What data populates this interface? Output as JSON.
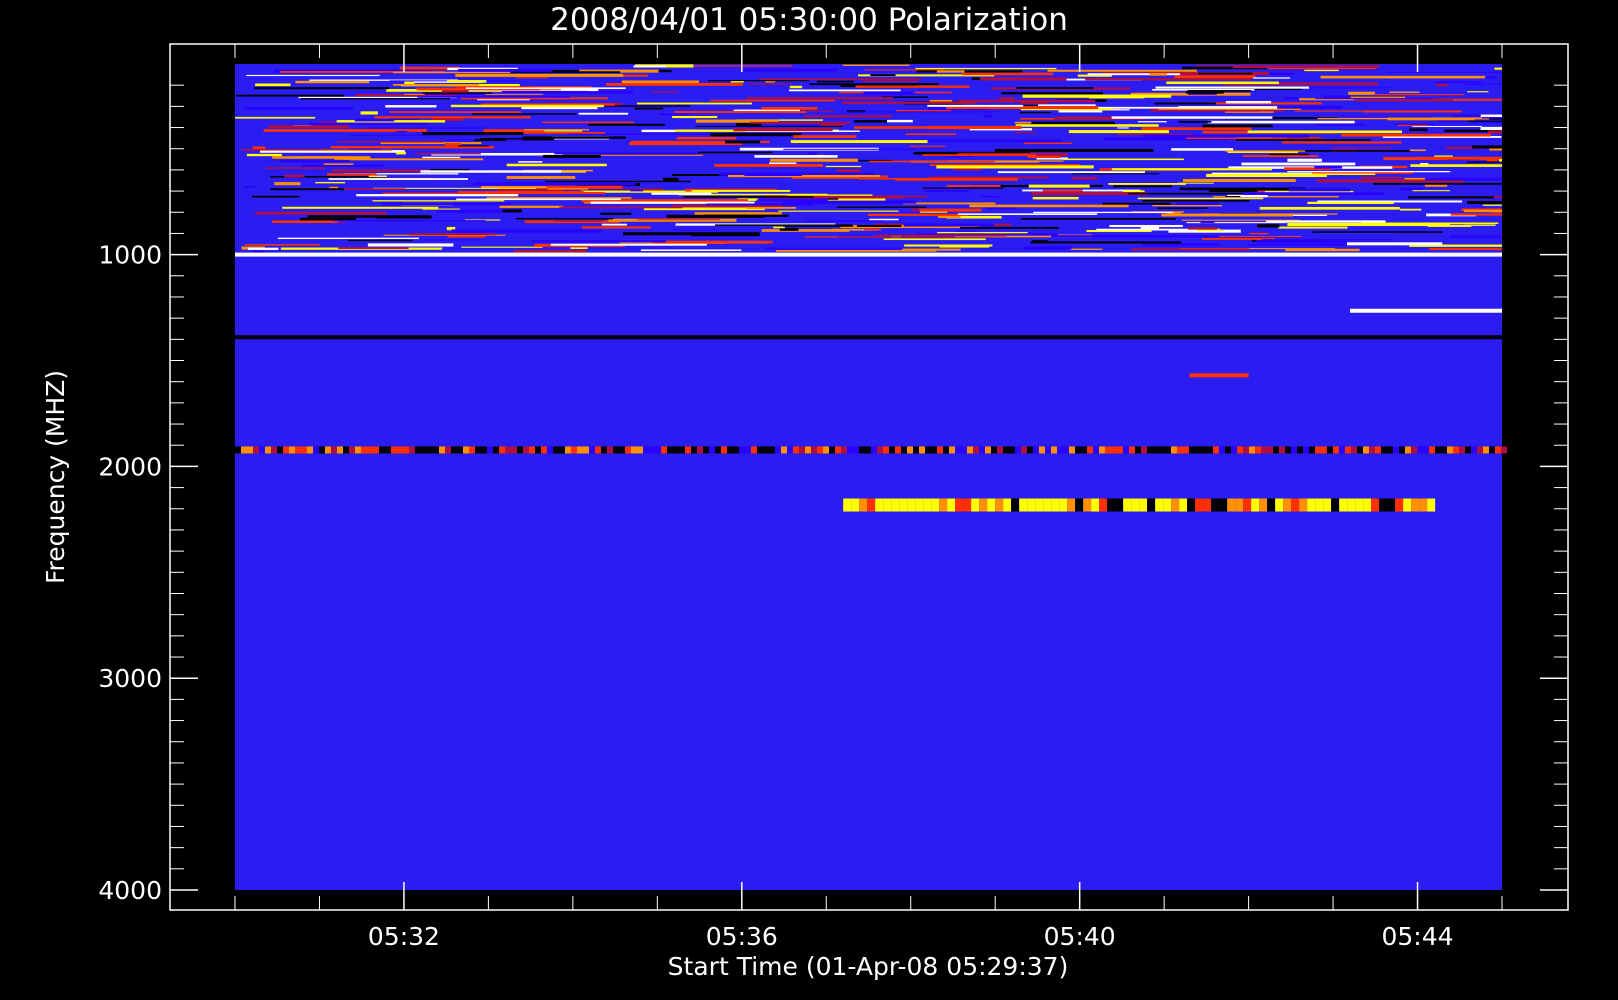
{
  "chart_data": {
    "type": "heatmap",
    "title": "2008/04/01 05:30:00 Polarization",
    "xlabel": "Start Time (01-Apr-08 05:29:37)",
    "ylabel": "Frequency (MHZ)",
    "x_start_minutes": 0,
    "x_range_minutes": [
      0,
      15
    ],
    "x_ticks": [
      {
        "label": "05:32",
        "minutes": 2
      },
      {
        "label": "05:36",
        "minutes": 6
      },
      {
        "label": "05:40",
        "minutes": 10
      },
      {
        "label": "05:44",
        "minutes": 14
      }
    ],
    "ylim": [
      100,
      4000
    ],
    "y_inverted": true,
    "y_ticks": [
      1000,
      2000,
      3000,
      4000
    ],
    "colormap": [
      "#000000",
      "#2a00ff",
      "#b01040",
      "#ff3000",
      "#ff9000",
      "#ffff00",
      "#ffffff"
    ],
    "background_color": "#2b1cf2",
    "features": [
      {
        "name": "rfi-band-top",
        "freq_range": [
          100,
          980
        ],
        "intensity": "mixed"
      },
      {
        "name": "white-line-1000",
        "freq": 1000,
        "color": "#ffffff"
      },
      {
        "name": "white-band-1260",
        "freq": 1265,
        "time_range": [
          13.2,
          15
        ],
        "color": "#ffffff"
      },
      {
        "name": "dark-line-1390",
        "freq": 1390,
        "color": "#000000"
      },
      {
        "name": "red-burst-1570",
        "freq": 1570,
        "time_range": [
          11.3,
          12.0
        ],
        "color": "#ff3000"
      },
      {
        "name": "band-1920",
        "freq": 1920,
        "color": "mixed"
      },
      {
        "name": "yellow-band-2180",
        "freq": 2180,
        "time_range": [
          7.2,
          14.2
        ],
        "color": "#ffff00"
      }
    ]
  }
}
